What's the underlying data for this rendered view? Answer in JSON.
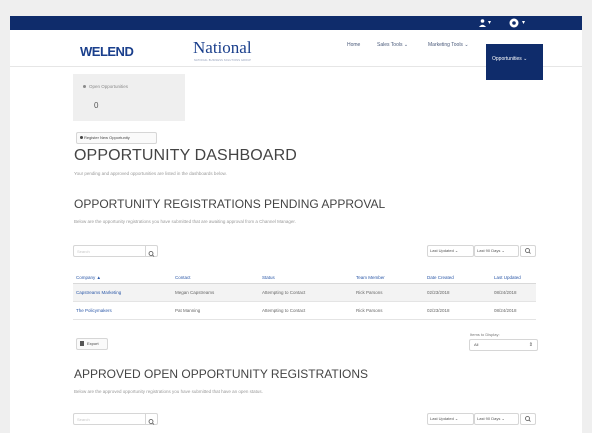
{
  "topbar": {
    "user_icon": "user-icon",
    "settings_icon": "gear-icon",
    "caret": "▾"
  },
  "header": {
    "logo_welend": "WELEND",
    "logo_national": "National",
    "logo_national_sub": "NATIONAL BUSINESS SOLUTIONS GROUP",
    "nav": {
      "home": "Home",
      "sales_tools": "Sales Tools ⌄",
      "marketing_tools": "Marketing Tools ⌄",
      "opportunities": "Opportunities ⌄"
    }
  },
  "summary_card": {
    "title": "Open Opportunities",
    "count": "0"
  },
  "register_button": "Register New Opportunity",
  "dashboard": {
    "title": "OPPORTUNITY DASHBOARD",
    "subtitle": "Your pending and approved opportunities are listed in the dashboards below."
  },
  "pending": {
    "title": "OPPORTUNITY REGISTRATIONS PENDING APPROVAL",
    "subtitle": "Below are the opportunity registrations you have submitted that are awaiting approval from a Channel Manager.",
    "search_placeholder": "Search",
    "sort_field": "Last Updated ⌄",
    "date_range": "Last 90 Days ⌄",
    "columns": [
      "Company ▲",
      "Contact",
      "Status",
      "Team Member",
      "Date Created",
      "Last Updated"
    ],
    "rows": [
      [
        "Capstreams Marketing",
        "Megan Capstreams",
        "Attempting to Contact",
        "Rick Parsons",
        "02/23/2018",
        "08/24/2018"
      ],
      [
        "The Policymakers",
        "Pat Manning",
        "Attempting to Contact",
        "Rick Parsons",
        "02/23/2018",
        "08/24/2018"
      ]
    ],
    "export_label": "Export",
    "items_label": "Items to Display:",
    "items_value": "All"
  },
  "approved": {
    "title": "APPROVED OPEN OPPORTUNITY REGISTRATIONS",
    "subtitle": "Below are the approved opportunity registrations you have submitted that have an open status.",
    "search_placeholder": "Search",
    "sort_field": "Last Updated ⌄",
    "date_range": "Last 90 Days ⌄"
  },
  "colors": {
    "navy": "#0f2c6b",
    "link": "#2b58a8"
  }
}
